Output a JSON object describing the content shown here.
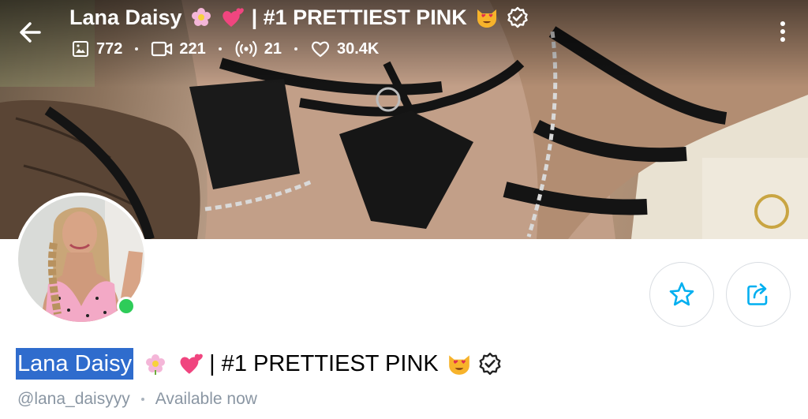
{
  "header": {
    "title_name": "Lana Daisy",
    "title_suffix": "| #1 PRETTIEST PINK",
    "emojis": [
      "flower-emoji",
      "two-hearts-emoji",
      "heart-eyes-cat-emoji",
      "verified-badge-icon"
    ]
  },
  "stats": {
    "photos": "772",
    "videos": "221",
    "streams": "21",
    "likes": "30.4K"
  },
  "profile": {
    "name": "Lana Daisy",
    "name_suffix": "| #1 PRETTIEST PINK",
    "handle": "@lana_daisyyy",
    "status": "Available now",
    "online": true
  },
  "colors": {
    "accent": "#00aff0",
    "online": "#2ecc59",
    "highlight": "#2f6ccd",
    "muted": "#8a96a3"
  }
}
